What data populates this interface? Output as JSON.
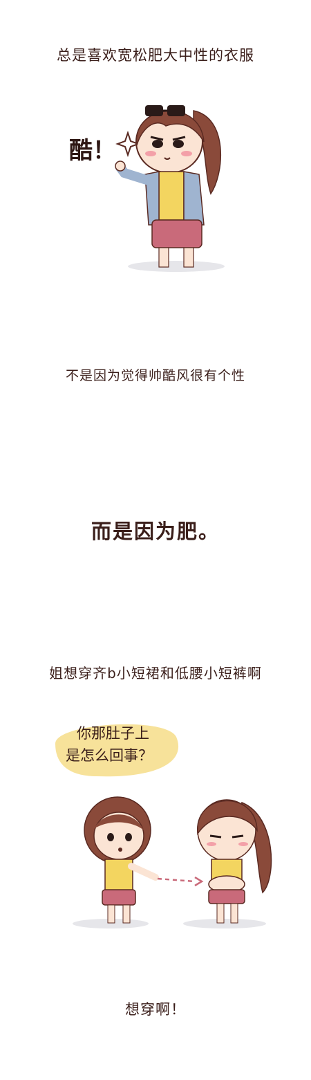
{
  "captions": {
    "line1": "总是喜欢宽松肥大中性的衣服",
    "exclaim": "酷！",
    "line2": "不是因为觉得帅酷风很有个性",
    "line3": "而是因为肥。",
    "line4": "姐想穿齐b小短裙和低腰小短裤啊",
    "bubble_line1": "你那肚子上",
    "bubble_line2": "是怎么回事？",
    "line5": "想穿啊！"
  },
  "colors": {
    "hair": "#8a4a3a",
    "skin": "#fbe4d4",
    "jacket": "#9fb4d0",
    "top": "#f3d560",
    "shorts": "#c96a7a",
    "bubble": "#f7e29a",
    "outline": "#5a2a22"
  }
}
